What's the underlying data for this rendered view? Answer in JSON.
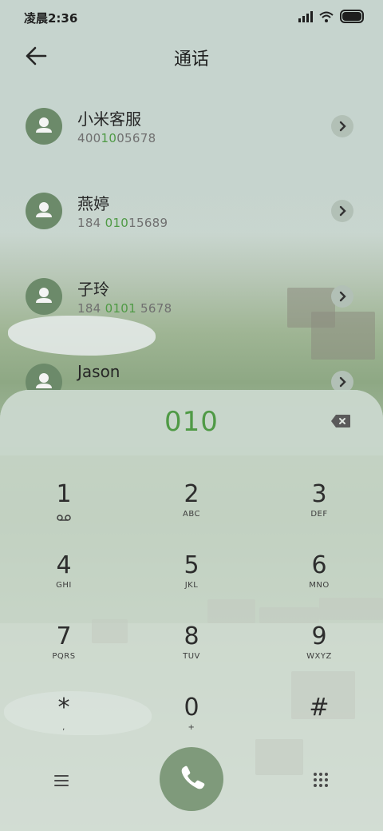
{
  "status": {
    "time": "凌晨2:36",
    "icons": [
      "signal-icon",
      "wifi-icon",
      "battery-icon"
    ]
  },
  "header": {
    "title": "通话",
    "back_icon": "arrow-left-icon"
  },
  "contacts": [
    {
      "name": "小米客服",
      "number_parts": [
        "400",
        "10",
        "05678"
      ]
    },
    {
      "name": "燕婷",
      "number_parts": [
        "184 ",
        "010",
        "15689"
      ]
    },
    {
      "name": "子玲",
      "number_parts": [
        "184 ",
        "0101",
        " 5678"
      ]
    },
    {
      "name": "Jason",
      "number_parts": [
        "",
        "",
        ""
      ]
    }
  ],
  "dialer": {
    "input": "010",
    "keys": [
      {
        "digit": "1",
        "letters": ""
      },
      {
        "digit": "2",
        "letters": "ABC"
      },
      {
        "digit": "3",
        "letters": "DEF"
      },
      {
        "digit": "4",
        "letters": "GHI"
      },
      {
        "digit": "5",
        "letters": "JKL"
      },
      {
        "digit": "6",
        "letters": "MNO"
      },
      {
        "digit": "7",
        "letters": "PQRS"
      },
      {
        "digit": "8",
        "letters": "TUV"
      },
      {
        "digit": "9",
        "letters": "WXYZ"
      },
      {
        "digit": "*",
        "letters": ","
      },
      {
        "digit": "0",
        "letters": "+"
      },
      {
        "digit": "#",
        "letters": ""
      }
    ],
    "key1_icon": "voicemail-icon",
    "bottom_icons": [
      "menu-icon",
      "phone-icon",
      "keypad-icon"
    ]
  },
  "colors": {
    "accent": "#4f9a45",
    "call_button": "#7f9a7b",
    "avatar": "#6c8a6a"
  }
}
